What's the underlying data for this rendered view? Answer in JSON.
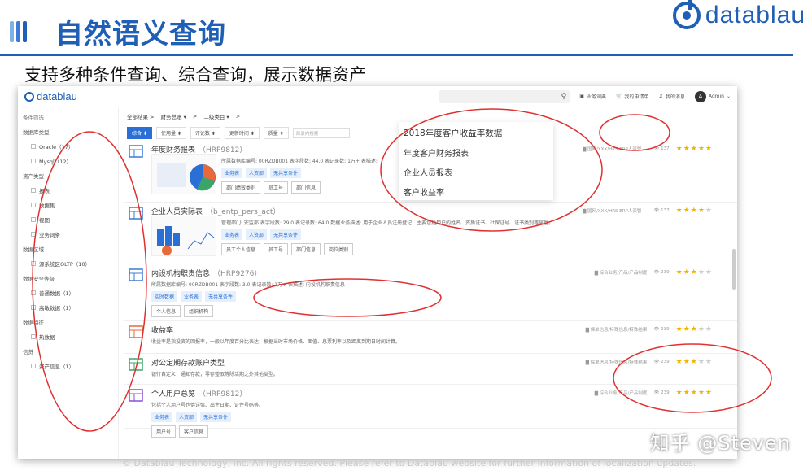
{
  "slide": {
    "title": "自然语义查询",
    "subtitle": "支持多种条件查询、综合查询，展示数据资产",
    "brand": "datablau",
    "watermark": "知乎 @Steven",
    "footer": "© Datablau Technology, Inc. All rights reserved. Please refer to Datablau website for further information of localization updates."
  },
  "colors": {
    "brand": "#1f5fb5",
    "accent": "#2a6fd6",
    "annotation": "#e03030",
    "star": "#f3b400"
  },
  "app": {
    "logo": "datablau",
    "search_icon": "search-icon",
    "topbar": [
      "业务词典",
      "我的申请单",
      "我的消息"
    ],
    "avatar": "A",
    "user": "Admin"
  },
  "sidebar": {
    "header": "条件筛选",
    "groups": [
      {
        "label": "数据库类型",
        "items": [
          "Oracle（17）",
          "Mysql（12）"
        ]
      },
      {
        "label": "资产类型",
        "items": [
          "报表",
          "数据集",
          "视图",
          "业务词条"
        ]
      },
      {
        "label": "数据区域",
        "items": [
          "源系统区OLTP（10）"
        ]
      },
      {
        "label": "数据安全等级",
        "items": [
          "普通数据（1）",
          "高敏数据（1）"
        ]
      },
      {
        "label": "数据特征",
        "items": [
          "热数据"
        ]
      },
      {
        "label": "信贷",
        "items": [
          "资产信息（1）"
        ]
      }
    ]
  },
  "breadcrumb": [
    "全部结果 >",
    "财务总账 ▾",
    ">",
    "二级类目 ▾",
    ">"
  ],
  "filters": {
    "chips": [
      "综合 ⬇",
      "使用量 ⬍",
      "评论数 ⬍",
      "更新时间 ⬍",
      "质量 ⬍"
    ],
    "placeholder": "目录内搜索"
  },
  "rows": [
    {
      "title": "年度财务报表",
      "code": "（HRP9812）",
      "desc": "所属数据库编号: 00RZDB001  表字段数: 44.0  表记录数: 1万+  表描述:",
      "tags": [
        "业务表",
        "人资部",
        "无共享条件"
      ],
      "btns": [
        "部门绩效类别",
        "员工号",
        "部门信息"
      ],
      "path": "▇ 国网/XXX/HRS ERP人资管 ···",
      "views": "👁 137",
      "stars": 5
    },
    {
      "title": "企业人员实际表",
      "code": "（b_entp_pers_act）",
      "desc": "管理部门: 安监部  表字段数: 29.0  表记录数: 64.0  数据业务描述: 用于企业人员注册登记，主要包括用户的姓名、资质证书、社保证号、证书类别等属性。",
      "tags": [
        "业务表",
        "人资部",
        "无共享条件"
      ],
      "btns": [
        "员工个人信息",
        "员工号",
        "部门信息",
        "岗位类别"
      ],
      "path": "▇ 国网/XXX/HRS ERP人资管 ···",
      "views": "👁 137",
      "stars": 4
    },
    {
      "title": "内设机构职责信息",
      "code": "（HRP9276）",
      "desc": "所属数据库编号: 00RZDB001  表字段数: 3.0  表记录数: 1万+  表描述: 内设机构职责信息",
      "tags": [
        "实时数据",
        "业务表",
        "无共享条件"
      ],
      "btns": [
        "个人信息",
        "组织机构"
      ],
      "path": "▇ 综合业务/产品/产品制度",
      "views": "👁 239",
      "stars": 3
    },
    {
      "title": "收益率",
      "code": "",
      "desc": "收益率是指投资的回报率，一般以年度百分比表达，根据当时市场价格、面值、息票利率以及距离到期日时间计算。",
      "tags": [],
      "btns": [],
      "path": "▇ 保单信息/特殊信息/特殊结果",
      "views": "👁 239",
      "stars": 3
    },
    {
      "title": "对公定期存款账户类型",
      "code": "",
      "desc": "银行自定义，通知存款，零存整取等除活期之外其他类型。",
      "tags": [],
      "btns": [],
      "path": "▇ 保单信息/特殊信息/特殊结果",
      "views": "👁 239",
      "stars": 3
    },
    {
      "title": "个人用户总览",
      "code": "（HRP9812）",
      "desc": "包括个人用户号也供详情、出生日期、证件号码等。",
      "tags": [
        "业务表",
        "人资部",
        "无共享条件"
      ],
      "btns": [
        "用户号",
        "客户信息"
      ],
      "path": "▇ 综合业务/产品/产品制度",
      "views": "👁 239",
      "stars": 5
    }
  ],
  "popup": {
    "title": "2018年度客户收益率数据",
    "items": [
      "年度客户财务报表",
      "企业人员报表",
      "客户收益率"
    ]
  }
}
